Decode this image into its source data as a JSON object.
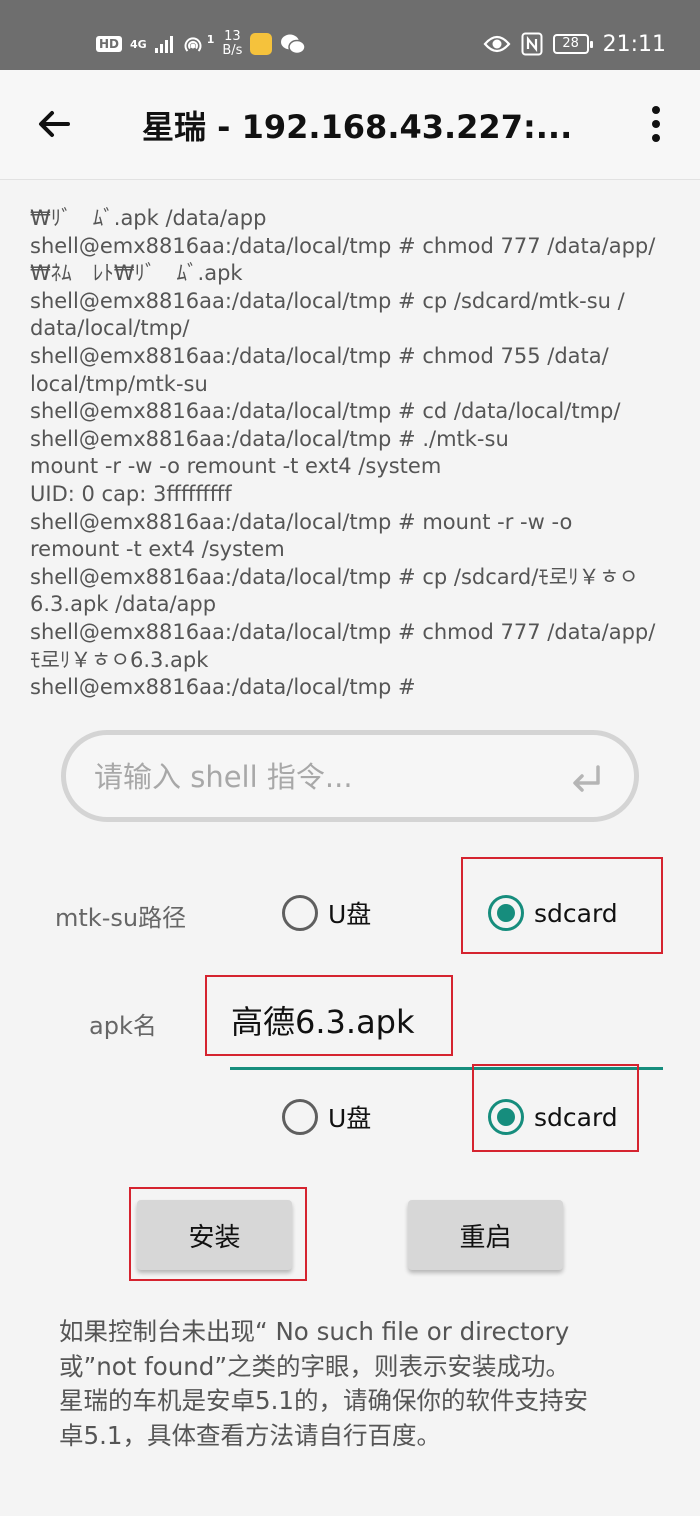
{
  "status_bar": {
    "hd": "HD",
    "net": "4G",
    "hotspot_count": "1",
    "speed_value": "13",
    "speed_unit": "B/s",
    "battery": "28",
    "time": "21:11"
  },
  "app_bar": {
    "title": "星瑞 - 192.168.43.227:..."
  },
  "console": {
    "lines": [
      "₩ﾘﾞ　ﾑﾞ.apk /data/app",
      "shell@emx8816aa:/data/local/tmp # chmod 777 /data/app/",
      "₩ﾈﾑ　ﾚﾄ₩ﾘﾞ　ﾑﾞ.apk",
      "shell@emx8816aa:/data/local/tmp # cp /sdcard/mtk-su /",
      "data/local/tmp/",
      "shell@emx8816aa:/data/local/tmp # chmod 755 /data/",
      "local/tmp/mtk-su",
      "shell@emx8816aa:/data/local/tmp # cd /data/local/tmp/",
      "shell@emx8816aa:/data/local/tmp # ./mtk-su",
      "mount -r -w -o remount -t ext4 /system",
      "UID: 0  cap: 3fffffffff",
      "shell@emx8816aa:/data/local/tmp # mount -r -w -o",
      "remount -t ext4 /system",
      "shell@emx8816aa:/data/local/tmp # cp /sdcard/ﾓ로ﾘ￥ㅎㅇ",
      "6.3.apk /data/app",
      "shell@emx8816aa:/data/local/tmp # chmod 777 /data/app/",
      "ﾓ로ﾘ￥ㅎㅇ6.3.apk",
      "shell@emx8816aa:/data/local/tmp #"
    ]
  },
  "shell_input": {
    "placeholder": "请输入 shell 指令...",
    "value": ""
  },
  "mtk_su": {
    "label": "mtk-su路径",
    "options": [
      {
        "label": "U盘",
        "checked": false
      },
      {
        "label": "sdcard",
        "checked": true
      }
    ]
  },
  "apk": {
    "label": "apk名",
    "value": "高德6.3.apk",
    "options": [
      {
        "label": "U盘",
        "checked": false
      },
      {
        "label": "sdcard",
        "checked": true
      }
    ]
  },
  "buttons": {
    "install": "安装",
    "reboot": "重启"
  },
  "note": {
    "lines": [
      "如果控制台未出现“ No such file or directory",
      "或”not found”之类的字眼，则表示安装成功。",
      "星瑞的车机是安卓5.1的，请确保你的软件支持安",
      "卓5.1，具体查看方法请自行百度。"
    ]
  },
  "colors": {
    "accent": "#168d7d",
    "highlight_box": "#d5232f",
    "status_bar": "#6e6e6e"
  },
  "icons": [
    "back-arrow-icon",
    "more-vertical-icon",
    "enter-key-icon",
    "eye-icon",
    "nfc-icon",
    "battery-icon",
    "signal-icon",
    "hotspot-icon",
    "wechat-icon"
  ]
}
